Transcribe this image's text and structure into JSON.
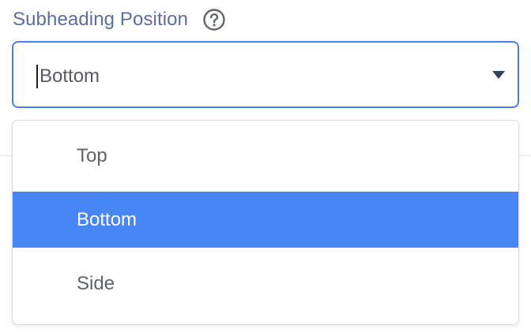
{
  "field": {
    "label": "Subheading Position",
    "help_icon": "question-circle-icon",
    "selected_value": "Bottom"
  },
  "menu": {
    "options": [
      {
        "label": "Top"
      },
      {
        "label": "Bottom"
      },
      {
        "label": "Side"
      }
    ],
    "selected_index": 1
  },
  "colors": {
    "label": "#5a6ea1",
    "focus_border": "#4a7fe6",
    "selected_bg": "#4885f5",
    "option_text": "#5d6370"
  }
}
